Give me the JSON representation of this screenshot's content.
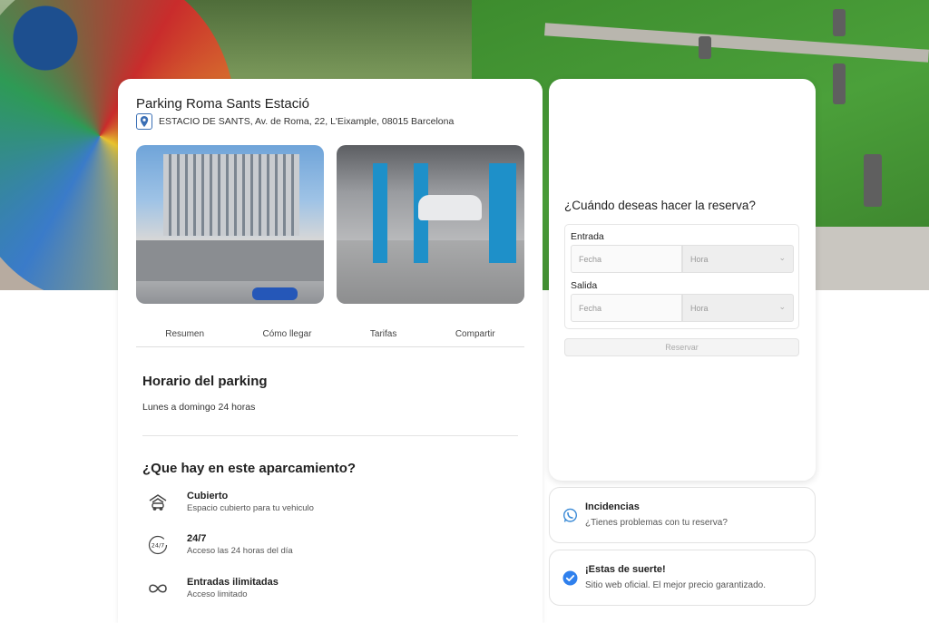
{
  "parking": {
    "name": "Parking Roma Sants Estació",
    "address": "ESTACIO DE SANTS, Av. de Roma, 22, L'Eixample, 08015 Barcelona"
  },
  "tabs": [
    "Resumen",
    "Cómo llegar",
    "Tarifas",
    "Compartir"
  ],
  "schedule": {
    "heading": "Horario del parking",
    "text": "Lunes a domingo 24 horas"
  },
  "features": {
    "heading": "¿Que hay en este aparcamiento?",
    "items": [
      {
        "title": "Cubierto",
        "subtitle": "Espacio cubierto para tu vehiculo",
        "icon": "covered-parking-icon"
      },
      {
        "title": "24/7",
        "subtitle": "Acceso las 24 horas del día",
        "icon": "clock-24-7-icon"
      },
      {
        "title": "Entradas ilimitadas",
        "subtitle": "Acceso limitado",
        "icon": "infinity-icon"
      }
    ]
  },
  "booking": {
    "question": "¿Cuándo deseas hacer la reserva?",
    "entry_label": "Entrada",
    "exit_label": "Salida",
    "date_placeholder": "Fecha",
    "time_placeholder": "Hora",
    "submit_label": "Reservar"
  },
  "incidents": {
    "title": "Incidencias",
    "subtitle": "¿Tienes problemas con tu reserva?",
    "icon": "whatsapp-icon"
  },
  "luck": {
    "title": "¡Estas de suerte!",
    "subtitle": "Sitio web oficial. El mejor precio garantizado.",
    "icon": "check-circle-icon"
  },
  "colors": {
    "accent_blue": "#3a6fb5",
    "check_blue": "#2f80ed",
    "whatsapp_blue": "#3a8ad6"
  }
}
